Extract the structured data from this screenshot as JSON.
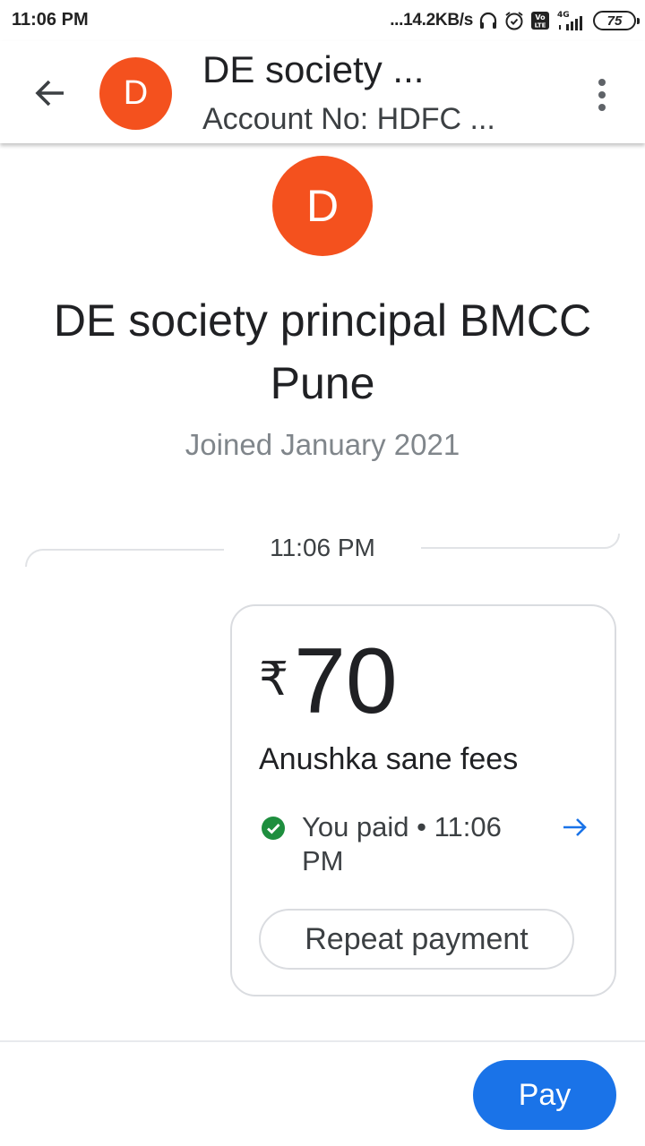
{
  "status_bar": {
    "time": "11:06 PM",
    "net_speed": "...14.2KB/s",
    "network": "4G",
    "battery": "75"
  },
  "header": {
    "avatar_letter": "D",
    "title": "DE society ...",
    "subtitle": "Account No: HDFC ..."
  },
  "profile": {
    "avatar_letter": "D",
    "name": "DE society principal BMCC Pune",
    "joined": "Joined January 2021"
  },
  "timeline": {
    "time": "11:06 PM"
  },
  "payment": {
    "currency": "₹",
    "amount": "70",
    "note": "Anushka sane fees",
    "status": "You paid • 11:06 PM",
    "repeat_label": "Repeat payment"
  },
  "footer": {
    "pay_label": "Pay"
  },
  "colors": {
    "avatar": "#f4511e",
    "accent": "#1a73e8",
    "success": "#1e8e3e"
  }
}
